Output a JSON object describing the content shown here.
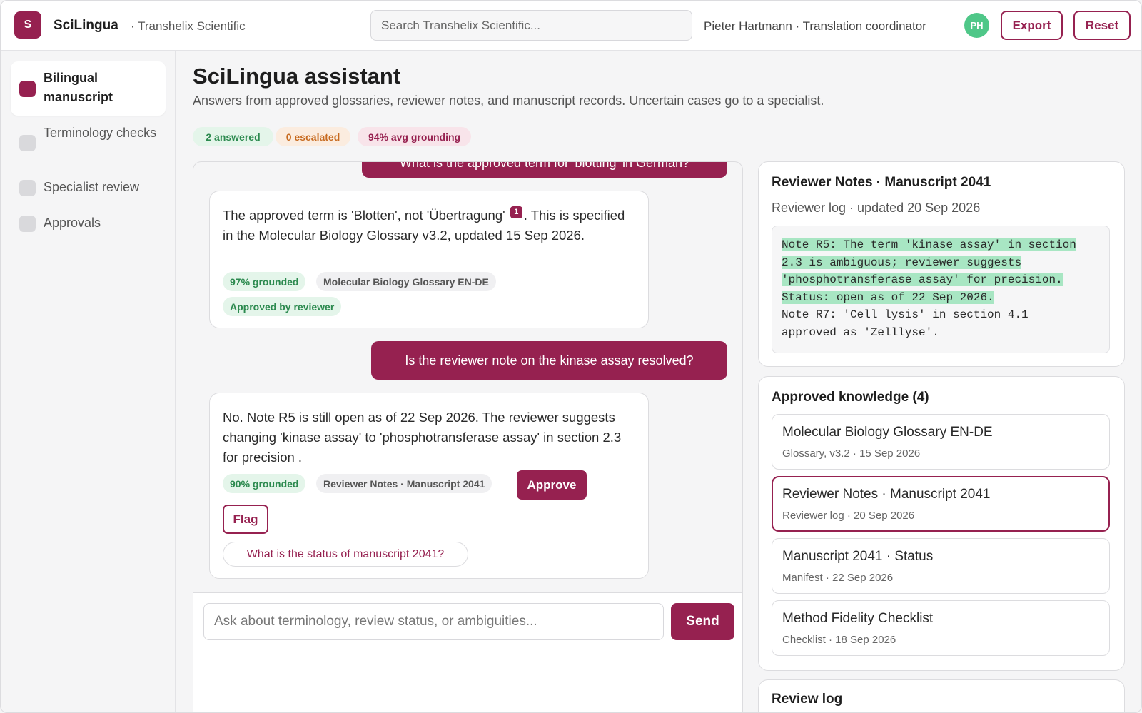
{
  "header": {
    "logo_letter": "S",
    "brand": "SciLingua",
    "org": "· Transhelix Scientific",
    "search_placeholder": "Search Transhelix Scientific...",
    "user": "Pieter Hartmann · Translation coordinator",
    "avatar_initials": "PH",
    "export_label": "Export",
    "reset_label": "Reset"
  },
  "sidebar": {
    "items": [
      {
        "label": "Bilingual manuscript",
        "active": true
      },
      {
        "label": "Terminology checks",
        "active": false
      },
      {
        "label": "Specialist review",
        "active": false
      },
      {
        "label": "Approvals",
        "active": false
      }
    ]
  },
  "main": {
    "title": "SciLingua assistant",
    "subtitle": "Answers from approved glossaries, reviewer notes, and manuscript records. Uncertain cases go to a specialist.",
    "stats": {
      "answered": "2 answered",
      "escalated": "0 escalated",
      "grounding": "94% avg grounding"
    }
  },
  "chat": {
    "messages": [
      {
        "role": "user",
        "text": "What is the approved term for 'blotting' in German?"
      },
      {
        "role": "assistant",
        "text_before": "The approved term is 'Blotten', not 'Übertragung'",
        "citation": "1",
        "text_after": ". This is specified in the Molecular Biology Glossary v3.2, updated 15 Sep 2026.",
        "grounding": "97% grounded",
        "source": "Molecular Biology Glossary EN-DE",
        "status": "Approved by reviewer"
      },
      {
        "role": "user",
        "text": "Is the reviewer note on the kinase assay resolved?"
      },
      {
        "role": "assistant",
        "text": "No. Note R5 is still open as of 22 Sep 2026. The reviewer suggests changing 'kinase assay' to 'phosphotransferase assay' in section 2.3 for precision .",
        "grounding": "90% grounded",
        "source": "Reviewer Notes · Manuscript 2041",
        "approve_label": "Approve",
        "flag_label": "Flag",
        "followup": "What is the status of manuscript 2041?"
      }
    ],
    "composer_placeholder": "Ask about terminology, review status, or ambiguities...",
    "send_label": "Send"
  },
  "notes_panel": {
    "title": "Reviewer Notes · Manuscript 2041",
    "subtitle": "Reviewer log · updated 20 Sep 2026",
    "highlighted_lines": [
      "Note R5: The term 'kinase assay' in section",
      "2.3 is ambiguous; reviewer suggests",
      "'phosphotransferase assay' for precision.",
      "Status: open as of 22 Sep 2026."
    ],
    "plain_lines": [
      "Note R7: 'Cell lysis' in section 4.1",
      "approved as 'Zelllyse'."
    ],
    "highlight_color": "#a8e6c3"
  },
  "knowledge": {
    "title": "Approved knowledge (4)",
    "items": [
      {
        "title": "Molecular Biology Glossary EN-DE",
        "meta": "Glossary, v3.2 · 15 Sep 2026",
        "selected": false
      },
      {
        "title": "Reviewer Notes · Manuscript 2041",
        "meta": "Reviewer log · 20 Sep 2026",
        "selected": true
      },
      {
        "title": "Manuscript 2041 · Status",
        "meta": "Manifest · 22 Sep 2026",
        "selected": false
      },
      {
        "title": "Method Fidelity Checklist",
        "meta": "Checklist · 18 Sep 2026",
        "selected": false
      }
    ]
  },
  "review_log": {
    "title": "Review log"
  },
  "colors": {
    "accent": "#962150",
    "success": "#2c8a4f",
    "warning": "#c76a1f",
    "avatar": "#4fc788"
  }
}
